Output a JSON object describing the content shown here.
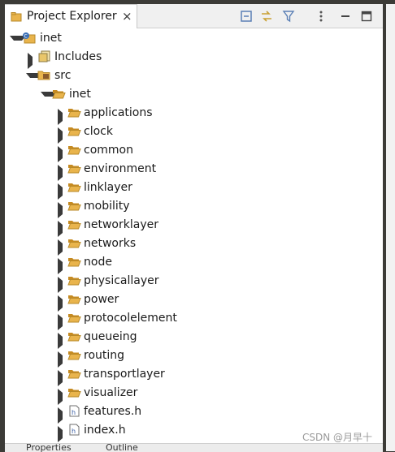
{
  "view": {
    "title": "Project Explorer",
    "close_glyph": "×"
  },
  "toolbar": {
    "icons": [
      "collapse-all-icon",
      "link-with-editor-icon",
      "filter-icon",
      "view-menu-icon",
      "minimize-icon",
      "maximize-icon"
    ]
  },
  "tree": {
    "project": "inet",
    "includes": "Includes",
    "src": "src",
    "package": "inet",
    "folders": [
      "applications",
      "clock",
      "common",
      "environment",
      "linklayer",
      "mobility",
      "networklayer",
      "networks",
      "node",
      "physicallayer",
      "power",
      "protocolelement",
      "queueing",
      "routing",
      "transportlayer",
      "visualizer"
    ],
    "files": [
      "features.h",
      "index.h"
    ]
  },
  "bottom_tabs": {
    "properties": "Properties",
    "outline": "Outline"
  },
  "watermark": "CSDN @月早十",
  "colors": {
    "folder": "#e9b44c",
    "folder_dark": "#c68b22",
    "project_blue": "#3b6fb6",
    "panel_bg": "#ffffff",
    "chrome": "#3c3b37"
  }
}
